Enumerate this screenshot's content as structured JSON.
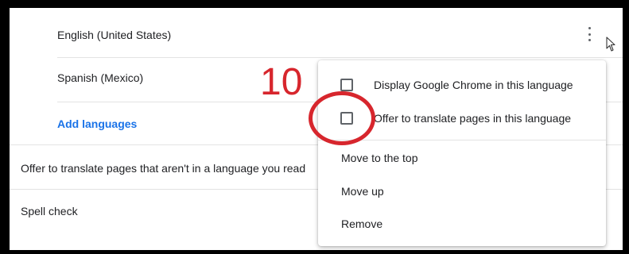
{
  "languages": {
    "items": [
      {
        "label": "English (United States)"
      },
      {
        "label": "Spanish (Mexico)"
      }
    ],
    "add_link": "Add languages"
  },
  "settings": {
    "offer_translate": "Offer to translate pages that aren't in a language you read",
    "spell_check": "Spell check"
  },
  "menu": {
    "display_language": "Display Google Chrome in this language",
    "offer_translate": "Offer to translate pages in this language",
    "move_top": "Move to the top",
    "move_up": "Move up",
    "remove": "Remove"
  },
  "annotation": {
    "step_number": "10",
    "color": "#d7262d"
  },
  "icons": {
    "kebab": "more-vert-icon",
    "cursor": "mouse-pointer-icon"
  },
  "accent_color": "#1a73e8"
}
